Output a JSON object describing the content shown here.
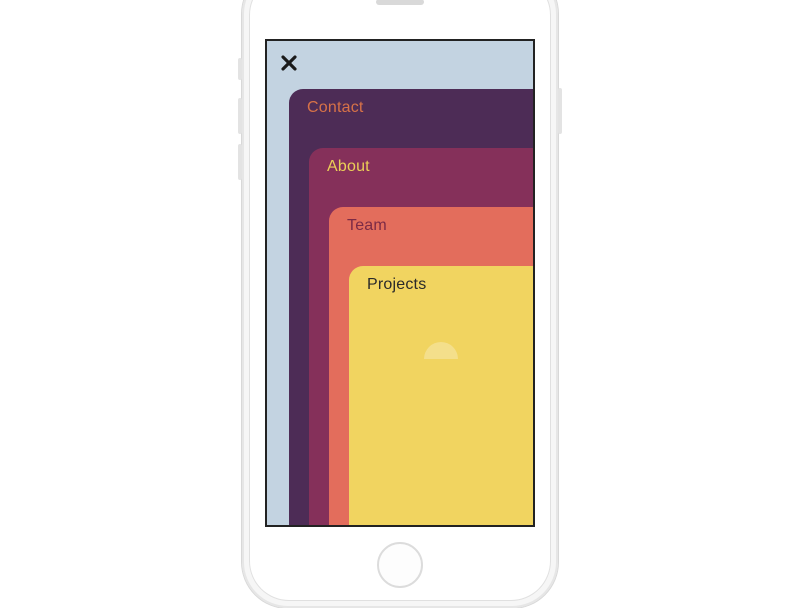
{
  "nav": {
    "cards": [
      {
        "label": "Contact",
        "bg": "#4d2c56",
        "text": "#d77248"
      },
      {
        "label": "About",
        "bg": "#85305a",
        "text": "#ebcf57"
      },
      {
        "label": "Team",
        "bg": "#e36d5c",
        "text": "#7c2a46"
      },
      {
        "label": "Projects",
        "bg": "#f1d460",
        "text": "#2a2a2a"
      }
    ]
  },
  "screen_bg": "#c3d3e1"
}
